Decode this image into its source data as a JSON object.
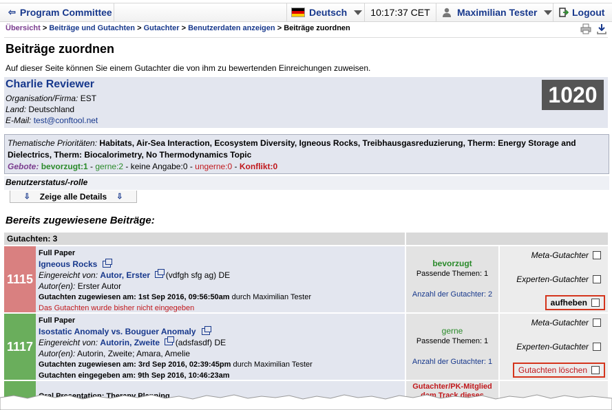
{
  "topbar": {
    "back_label": "Program Committee",
    "language": "Deutsch",
    "time": "10:17:37 CET",
    "user": "Maximilian Tester",
    "logout": "Logout"
  },
  "breadcrumb": {
    "items": [
      "Übersicht",
      "Beiträge und Gutachten",
      "Gutachter",
      "Benutzerdaten anzeigen"
    ],
    "current": "Beiträge zuordnen",
    "separator": ">"
  },
  "page": {
    "title": "Beiträge zuordnen",
    "intro": "Auf dieser Seite können Sie einem Gutachter die von ihm zu bewertenden Einreichungen zuweisen."
  },
  "reviewer": {
    "name": "Charlie Reviewer",
    "org_label": "Organisation/Firma:",
    "org": "EST",
    "country_label": "Land:",
    "country": "Deutschland",
    "email_label": "E-Mail:",
    "email": "test@conftool.net",
    "id": "1020"
  },
  "topics": {
    "label": "Thematische Prioritäten:",
    "value": "Habitats, Air-Sea Interaction, Ecosystem Diversity, Igneous Rocks, Treibhausgasreduzierung, Therm: Energy Storage and Dielectrics, Therm: Biocalorimetry, No Thermodynamics Topic"
  },
  "bids": {
    "label": "Gebote:",
    "bevorzugt": "bevorzugt:1",
    "gerne": "gerne:2",
    "keine": "keine Angabe:0",
    "ungerne": "ungerne:0",
    "konflikt": "Konflikt:0",
    "sep": " - "
  },
  "status_label": "Benutzerstatus/-rolle",
  "details_button": "Zeige alle Details",
  "assigned": {
    "heading": "Bereits zugewiesene Beiträge:",
    "count_label": "Gutachten: 3",
    "rows": [
      {
        "id": "1115",
        "color": "#d98080",
        "type": "Full Paper",
        "title": "Igneous Rocks",
        "submitted_by_label": "Eingereicht von:",
        "submitter": "Autor, Erster",
        "submitter_extra": "(vdfgh sfg ag) DE",
        "authors_label": "Autor(en):",
        "authors": "Erster Autor",
        "assigned_label": "Gutachten zugewiesen am:",
        "assigned_date": "1st Sep 2016, 09:56:50am",
        "assigned_by": "durch Maximilian Tester",
        "status_text": "Das Gutachten wurde bisher nicht eingegeben",
        "bid": "bevorzugt",
        "bid_color": "#2a8a2a",
        "matching": "Passende Themen: 1",
        "reviewer_count": "Anzahl der Gutachter: 2",
        "opt_meta": "Meta-Gutachter",
        "opt_expert": "Experten-Gutachter",
        "action": "aufheben"
      },
      {
        "id": "1117",
        "color": "#6aae5c",
        "type": "Full Paper",
        "title": "Isostatic Anomaly vs. Bouguer Anomaly",
        "submitted_by_label": "Eingereicht von:",
        "submitter": "Autorin, Zweite",
        "submitter_extra": "(adsfasdf) DE",
        "authors_label": "Autor(en):",
        "authors": "Autorin, Zweite; Amara, Amelie",
        "assigned_label": "Gutachten zugewiesen am:",
        "assigned_date": "3rd Sep 2016, 02:39:45pm",
        "assigned_by": "durch Maximilian Tester",
        "entered_label": "Gutachten eingegeben am:",
        "entered_date": "9th Sep 2016, 10:46:23am",
        "bid": "gerne",
        "bid_color": "#2a8a2a",
        "matching": "Passende Themen: 1",
        "reviewer_count": "Anzahl der Gutachter: 1",
        "opt_meta": "Meta-Gutachter",
        "opt_expert": "Experten-Gutachter",
        "action": "Gutachten löschen"
      },
      {
        "id": "",
        "color": "#6aae5c",
        "type": "Oral Presentation: Therapy Planning",
        "mid_text": "Gutachter/PK-Mitglied dem Track dieses"
      }
    ]
  },
  "colors": {
    "link": "#17388c",
    "accent_red": "#c0181c",
    "panel": "#e3e6ef"
  }
}
